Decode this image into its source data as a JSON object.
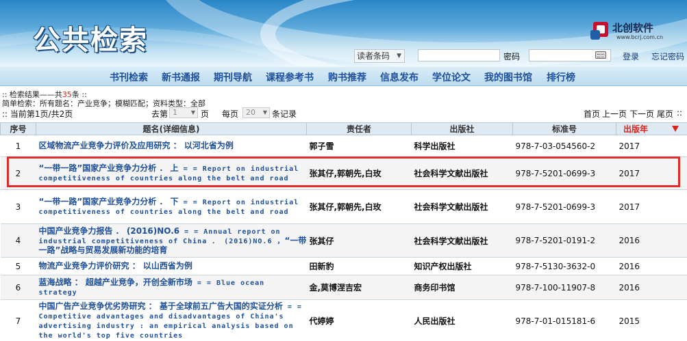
{
  "header": {
    "site_title": "公共检索",
    "brand_name": "北创软件",
    "brand_url": "www.bcrj.com.cn"
  },
  "login": {
    "reader_select": "读者条码",
    "password_label": "密码",
    "login_link": "登录",
    "forgot_link": "忘记密码"
  },
  "nav": {
    "items": [
      "书刊检索",
      "新书通报",
      "期刊导航",
      "课程参考书",
      "购书推荐",
      "信息发布",
      "学位论文",
      "我的图书馆",
      "排行榜"
    ]
  },
  "summary": {
    "result_prefix": ":: 检索结果——共",
    "result_count": "35",
    "result_suffix": "条 ::",
    "query_line": "简单检索：所有题名：产业竞争；模糊匹配；资料类型：全部"
  },
  "pager": {
    "current_prefix": ":: 当前第",
    "current_page": "1",
    "current_mid": "页/共",
    "total_pages": "2",
    "current_suffix": "页",
    "goto_label": "去第",
    "goto_value": "1",
    "goto_suffix": "页",
    "per_page_label": "每页",
    "per_page_value": "20",
    "per_page_suffix": "条记录",
    "first": "首页",
    "prev": "上一页",
    "next": "下一页",
    "last": "尾页",
    "end_marker": "::"
  },
  "table": {
    "headers": {
      "no": "序号",
      "title": "题名(详细信息)",
      "author": "责任者",
      "publisher": "出版社",
      "isbn": "标准号",
      "year": "出版年"
    },
    "rows": [
      {
        "no": "1",
        "title_cn": "区域物流产业竞争力评价及应用研究 ： 以河北省为例",
        "title_en": "",
        "title_tail": "",
        "author": "郭子雪",
        "publisher": "科学出版社",
        "isbn": "978-7-03-054560-2",
        "year": "2017"
      },
      {
        "no": "2",
        "title_cn": "“一带一路”国家产业竞争力分析 ． 上",
        "title_en": " = = Report on industrial competitiveness of countries along the belt and road",
        "title_tail": "",
        "author": "张其仔,郭朝先,白玫",
        "publisher": "社会科学文献出版社",
        "isbn": "978-7-5201-0699-3",
        "year": "2017"
      },
      {
        "no": "3",
        "title_cn": "“一带一路”国家产业竞争力分析 ． 下",
        "title_en": " = = Report on industrial competitiveness of countries along the belt and road",
        "title_tail": "",
        "author": "张其仔,郭朝先,白玫",
        "publisher": "社会科学文献出版社",
        "isbn": "978-7-5201-0699-3",
        "year": "2017"
      },
      {
        "no": "4",
        "title_cn": "中国产业竞争力报告 ． (2016)NO.6",
        "title_en": " = = Annual report on industrial competitiveness of China ． (2016)NO.6 ，",
        "title_tail": "“一带一路”战略与贸易发展新功能的培育",
        "author": "张其仔",
        "publisher": "社会科学文献出版社",
        "isbn": "978-7-5201-0191-2",
        "year": "2016"
      },
      {
        "no": "5",
        "title_cn": "物流产业竞争力评价研究 ： 以山西省为例",
        "title_en": "",
        "title_tail": "",
        "author": "田新豹",
        "publisher": "知识产权出版社",
        "isbn": "978-7-5130-3632-0",
        "year": "2016"
      },
      {
        "no": "6",
        "title_cn": "蓝海战略 ： 超越产业竞争，开创全新市场",
        "title_en": " = = Blue ocean strategy",
        "title_tail": "",
        "author": "金,莫博涅吉宏",
        "publisher": "商务印书馆",
        "isbn": "978-7-100-11907-8",
        "year": "2016"
      },
      {
        "no": "7",
        "title_cn": "中国广告产业竞争优劣势研究 ： 基于全球前五广告大国的实证分析",
        "title_en": " = = Competitive advantages and disadvantages of China's advertising industry : an empirical analysis based on the world's top five countries",
        "title_tail": "",
        "author": "代婷婷",
        "publisher": "人民出版社",
        "isbn": "978-7-01-015181-6",
        "year": "2015"
      }
    ]
  },
  "colors": {
    "nav_text": "#1d4f9a",
    "highlight": "#e02b2b",
    "sort_accent": "#d9241f"
  }
}
